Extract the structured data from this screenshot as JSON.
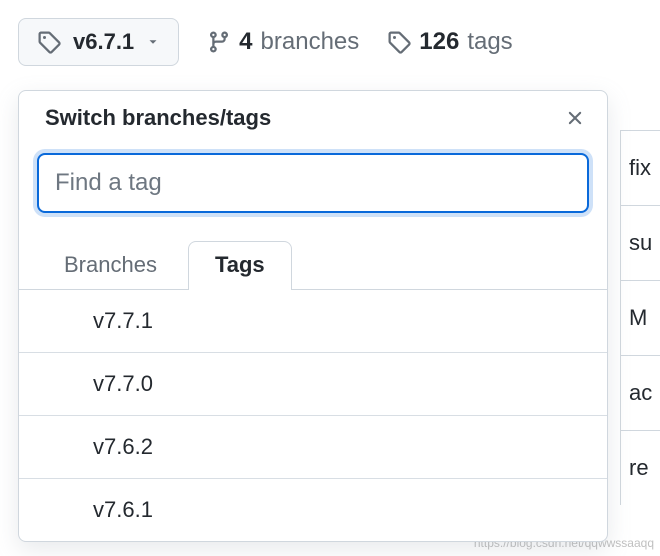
{
  "topbar": {
    "current_tag": "v6.7.1",
    "branches_count": "4",
    "branches_label": "branches",
    "tags_count": "126",
    "tags_label": "tags"
  },
  "dropdown": {
    "title": "Switch branches/tags",
    "search_placeholder": "Find a tag",
    "tabs": {
      "branches": "Branches",
      "tags": "Tags"
    },
    "items": [
      "v7.7.1",
      "v7.7.0",
      "v7.6.2",
      "v7.6.1"
    ]
  },
  "bg_rows": [
    "fix",
    "su",
    "M",
    "ac",
    "re"
  ],
  "watermark": "https://blog.csdn.net/qqwwssaaqq"
}
